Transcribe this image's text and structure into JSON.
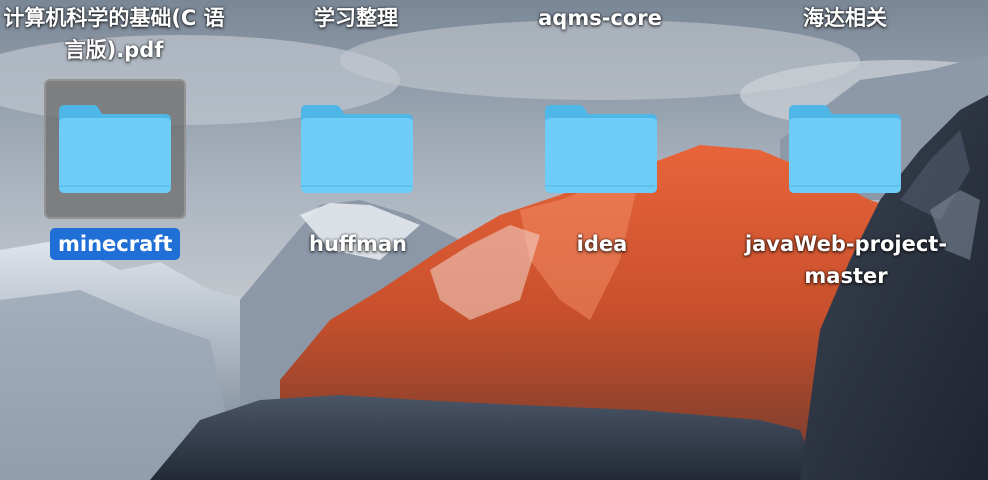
{
  "desktop": {
    "top_row": [
      {
        "label": "计算机科学的基础(C 语言版).pdf"
      },
      {
        "label": "学习整理"
      },
      {
        "label": "aqms-core"
      },
      {
        "label": "海达相关"
      }
    ],
    "folders": [
      {
        "label": "minecraft",
        "selected": true
      },
      {
        "label": "huffman",
        "selected": false
      },
      {
        "label": "idea",
        "selected": false
      },
      {
        "label": "javaWeb-project-master",
        "selected": false
      }
    ]
  },
  "colors": {
    "folder_front": "#6ecdf6",
    "folder_back": "#4fb6e8",
    "selection_label": "#1f6fd6",
    "selection_frame": "#6e6e6e"
  },
  "icons": {
    "folder": "folder-icon"
  }
}
